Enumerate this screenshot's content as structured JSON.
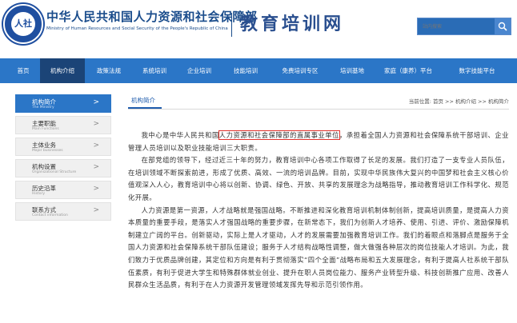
{
  "header": {
    "logo_text": "人社",
    "org_name_cn": "中华人民共和国人力资源和社会保障部",
    "org_name_en": "Ministry of Human Resources and Social Security of the People's Republic of China",
    "brand": "教育培训网",
    "search_placeholder": "站内搜索"
  },
  "nav": {
    "items": [
      {
        "label": "首页"
      },
      {
        "label": "机构介绍",
        "active": true
      },
      {
        "label": "政策法规"
      },
      {
        "label": "系统培训"
      },
      {
        "label": "企业培训"
      },
      {
        "label": "技能培训"
      },
      {
        "label": "免费培训专区"
      },
      {
        "label": "培训基地"
      },
      {
        "label": "家庭（康养）平台"
      },
      {
        "label": "数字技能平台"
      }
    ]
  },
  "sidebar": {
    "items": [
      {
        "cn": "机构简介",
        "en": "The Ministry",
        "active": true
      },
      {
        "cn": "主要职能",
        "en": "Main Functions"
      },
      {
        "cn": "主体业务",
        "en": "Major businesses"
      },
      {
        "cn": "机构设置",
        "en": "Organizational Structure"
      },
      {
        "cn": "历史沿革",
        "en": "History"
      },
      {
        "cn": "联系方式",
        "en": "Contact information"
      }
    ],
    "arrow": ">"
  },
  "content": {
    "title": "机构简介",
    "breadcrumb": "当前位置: 首页 >> 机构介绍 >> 机构简介",
    "p1_before": "我中心是中华人民共和国",
    "p1_highlight": "人力资源和社会保障部的直属事业单位",
    "p1_after": "，承担着全国人力资源和社会保障系统干部培训、企业管理人员培训以及职业技能培训三大职责。",
    "p2": "在部党组的领导下，经过近三十年的努力，教育培训中心各项工作取得了长足的发展。我们打造了一支专业人员队伍，在培训领域不断探索前进，形成了优质、高效、一流的培训品牌。目前，实现中华民族伟大复兴的中国梦和社会主义核心价值观深入人心，教育培训中心将以创新、协调、绿色、开放、共享的发展理念为战略指导，推动教育培训工作科学化、规范化开展。",
    "p3": "人力资源是第一资源，人才战略就是强国战略。不断推进和深化教育培训机制体制创新，提高培训质量，是提高人力资本质量的重要手段，是落实人才强国战略的重要步骤，在新常态下，我们为创新人才培养、使用、引进、评价、激励保障机制建立广阔的平台。创新驱动，实际上是人才驱动，人才的发展需要加强教育培训工作。我们的着眼点和落脚点是服务于全国人力资源和社会保障系统干部队伍建设；服务于人才结构战略性调整，做大做强各种层次的岗位技能人才培训。为此，我们致力于优质品牌创建，其定位和方向是有利于贯彻落实“四个全面”战略布局和五大发展理念，有利于提高人社系统干部队伍素质，有利于促进大学生和特殊群体就业创业、提升在职人员岗位能力、服务产业转型升级、科技创新推广应用、改善人民群众生活品质，有利于在人力资源开发管理领域发挥先导和示范引领作用。"
  }
}
